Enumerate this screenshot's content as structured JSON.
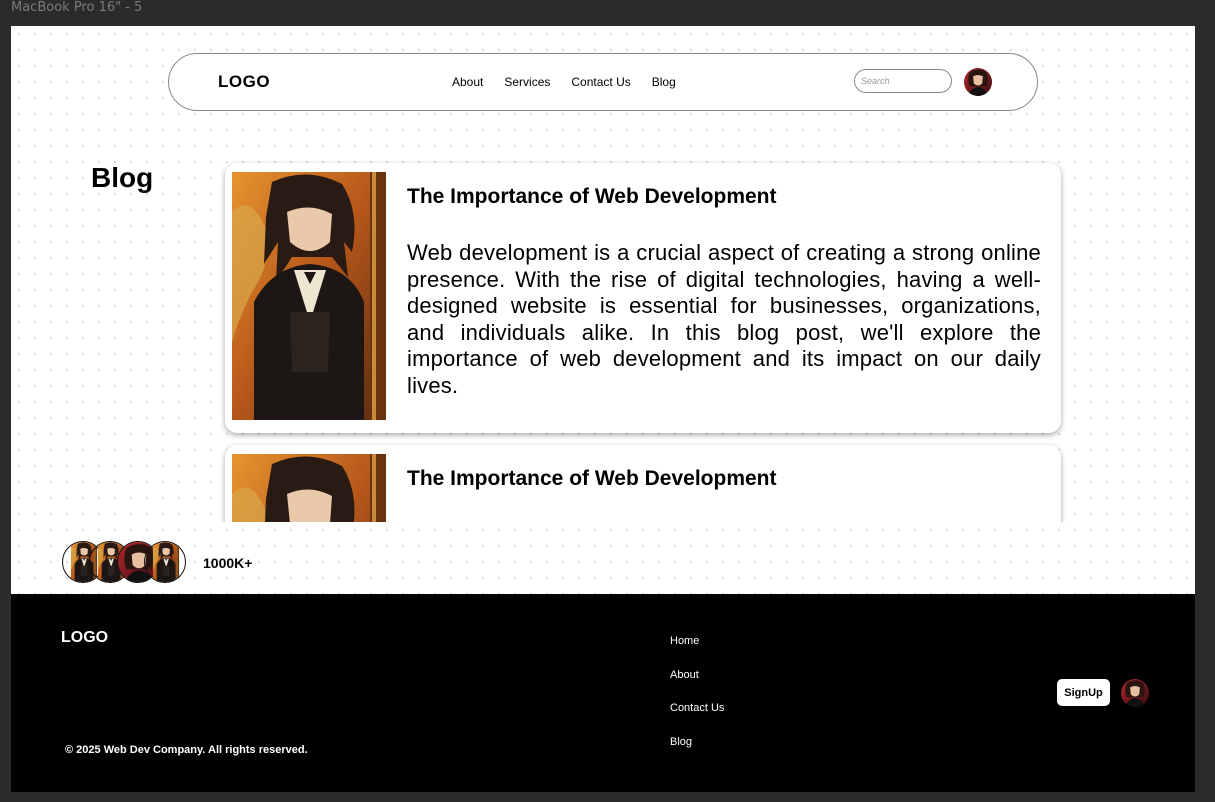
{
  "frame": {
    "label": "MacBook Pro 16\" - 5"
  },
  "header": {
    "logo": "LOGO",
    "nav": [
      "About",
      "Services",
      "Contact Us",
      "Blog"
    ],
    "search": {
      "placeholder": "Search",
      "value": ""
    },
    "avatar_icon": "user-avatar"
  },
  "blog": {
    "heading": "Blog",
    "posts": [
      {
        "title": "The Importance of Web Development",
        "body": "Web development is a crucial aspect of creating a strong online presence. With the rise of digital technologies, having a well-designed website is essential for businesses, organizations, and individuals alike. In this blog post, we'll explore the importance of web development and its impact on our daily lives.",
        "thumbnail_icon": "anime-character-image"
      },
      {
        "title": "The Importance of Web Development",
        "body": "",
        "thumbnail_icon": "anime-character-image"
      }
    ]
  },
  "community": {
    "count": "1000K+",
    "avatar_count": 4
  },
  "footer": {
    "logo": "LOGO",
    "links": [
      "Home",
      "About",
      "Contact Us",
      "Blog"
    ],
    "signup_label": "SignUp",
    "copyright": "© 2025 Web Dev Company. All rights reserved."
  },
  "colors": {
    "background": "#ffffff",
    "footer_bg": "#000000",
    "canvas_bg": "#2b2b2b",
    "accent_orange": "#c8741e"
  }
}
